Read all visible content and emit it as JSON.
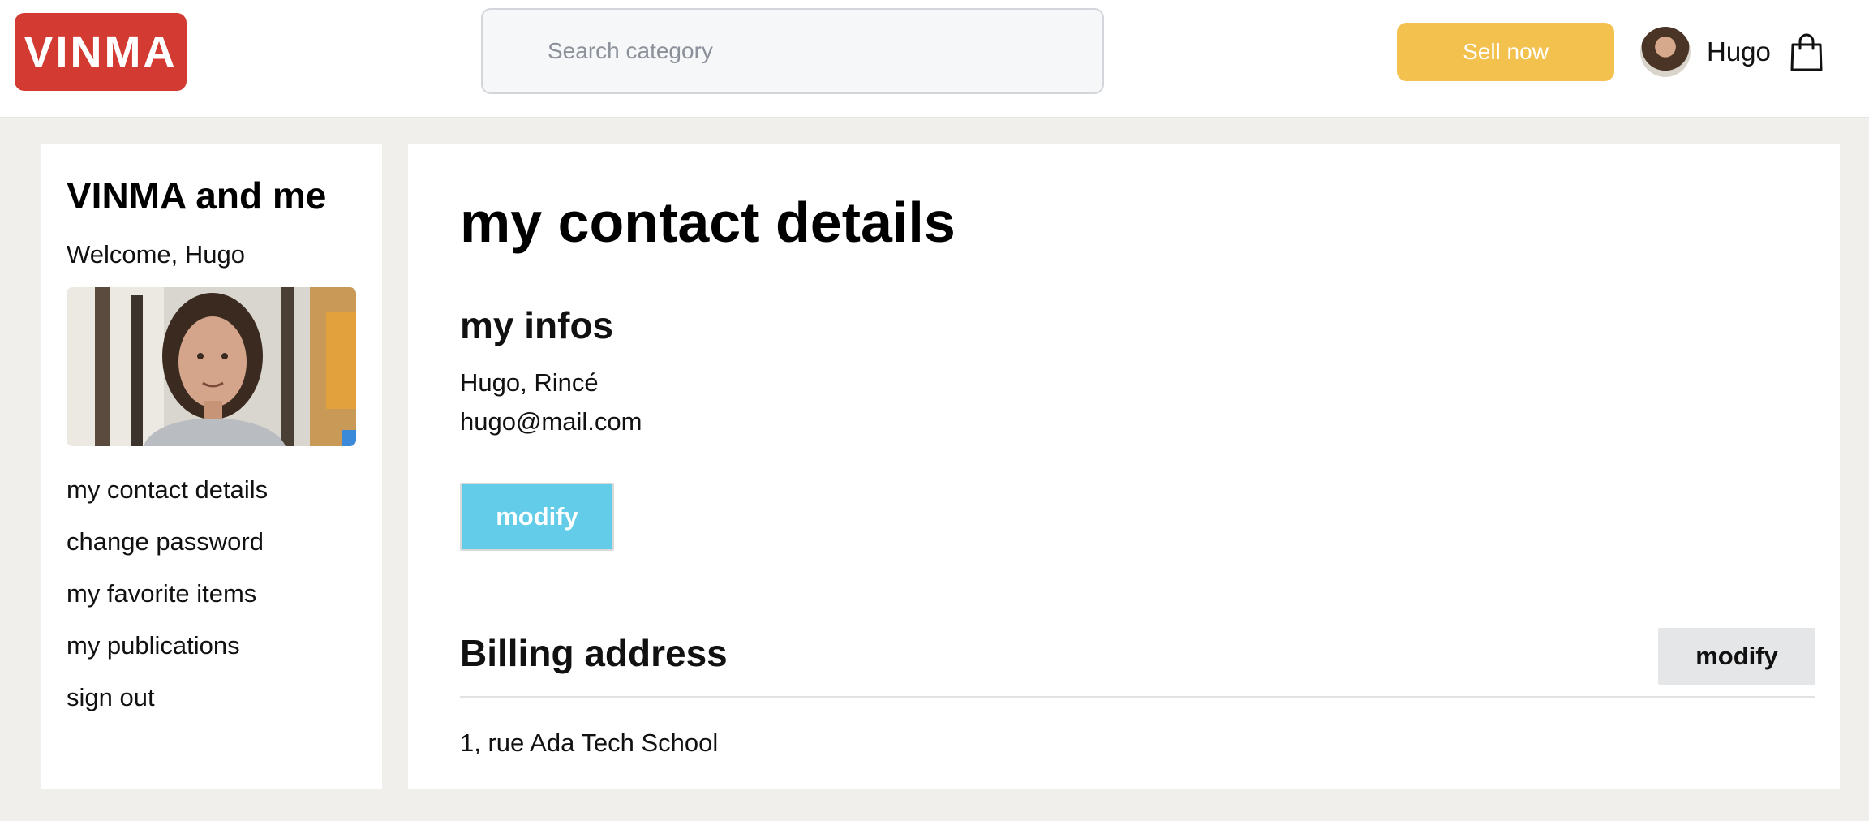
{
  "header": {
    "logo_text": "VINMA",
    "search_placeholder": "Search category",
    "sell_label": "Sell now",
    "user_name": "Hugo",
    "colors": {
      "logo": "#d33a32",
      "sell": "#f2c14e"
    }
  },
  "sidebar": {
    "title": "VINMA and me",
    "welcome": "Welcome, Hugo",
    "menu": [
      "my contact details",
      "change password",
      "my favorite items",
      "my publications",
      "sign out"
    ]
  },
  "main": {
    "title": "my contact details",
    "infos_title": "my infos",
    "name_line": "Hugo, Rincé",
    "email_line": "hugo@mail.com",
    "modify_label": "modify",
    "billing_title": "Billing address",
    "billing_modify_label": "modify",
    "address_line": "1, rue Ada Tech School",
    "colors": {
      "modify_primary": "#63cde9",
      "modify_secondary": "#e5e6e8"
    }
  }
}
